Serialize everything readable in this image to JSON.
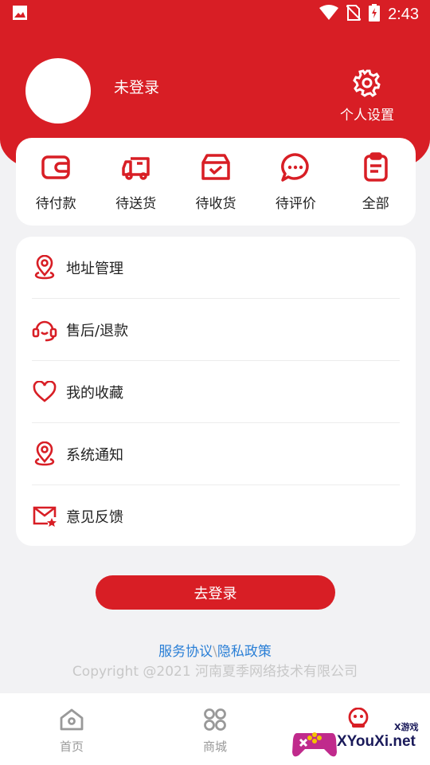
{
  "status_bar": {
    "time": "2:43"
  },
  "profile": {
    "name": "未登录",
    "settings_label": "个人设置"
  },
  "orders": [
    {
      "label": "待付款",
      "icon": "wallet-icon"
    },
    {
      "label": "待送货",
      "icon": "truck-icon"
    },
    {
      "label": "待收货",
      "icon": "box-icon"
    },
    {
      "label": "待评价",
      "icon": "chat-icon"
    },
    {
      "label": "全部",
      "icon": "clipboard-icon"
    }
  ],
  "menu": [
    {
      "label": "地址管理",
      "icon": "location-icon"
    },
    {
      "label": "售后/退款",
      "icon": "headset-icon"
    },
    {
      "label": "我的收藏",
      "icon": "heart-icon"
    },
    {
      "label": "系统通知",
      "icon": "location-icon"
    },
    {
      "label": "意见反馈",
      "icon": "mail-star-icon"
    }
  ],
  "login_button": "去登录",
  "policy": {
    "service": "服务协议",
    "separator": "\\",
    "privacy": "隐私政策"
  },
  "copyright": "Copyright @2021 河南夏季网络技术有限公司",
  "tabs": [
    {
      "label": "首页",
      "icon": "home-icon"
    },
    {
      "label": "商城",
      "icon": "grid-icon"
    },
    {
      "label": "",
      "icon": "profile-icon"
    }
  ],
  "watermark": {
    "text": "XYouXi.net",
    "small": "X游戏"
  },
  "colors": {
    "brand": "#d81e25",
    "link": "#2a7fd6"
  }
}
